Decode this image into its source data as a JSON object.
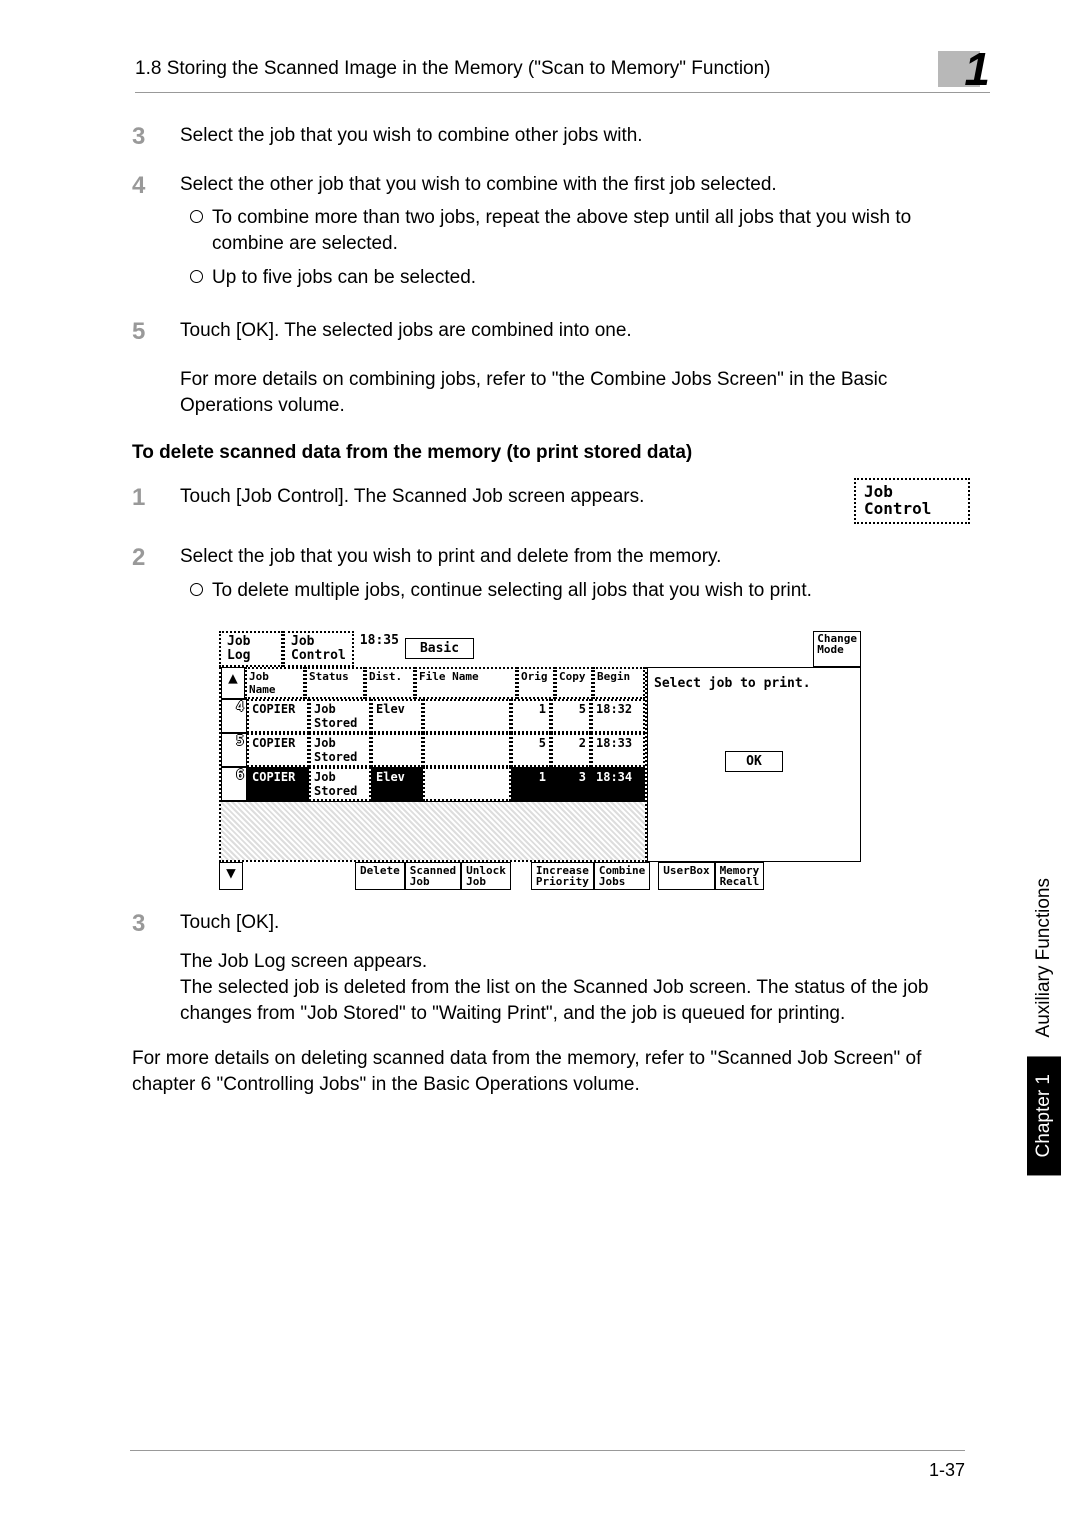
{
  "header": {
    "section_title": "1.8 Storing the Scanned Image in the Memory (\"Scan to Memory\" Function)",
    "chapter_number_glyph": "1"
  },
  "sidebar": {
    "chapter": "Chapter 1",
    "section": "Auxiliary Functions"
  },
  "steps_a": {
    "s3": {
      "n": "3",
      "text": "Select the job that you wish to combine other jobs with."
    },
    "s4": {
      "n": "4",
      "text": "Select the other job that you wish to combine with the first job selected.",
      "sub1": "To combine more than two jobs, repeat the above step until all jobs that you wish to combine are selected.",
      "sub2": "Up to five jobs can be selected."
    },
    "s5": {
      "n": "5",
      "text": "Touch [OK]. The selected jobs are combined into one.",
      "after": "For more details on combining jobs, refer to \"the Combine Jobs Screen\" in the Basic Operations volume."
    }
  },
  "h3": "To delete scanned data from the memory (to print stored data)",
  "job_control_btn": {
    "l1": "Job",
    "l2": "Control"
  },
  "steps_b": {
    "s1": {
      "n": "1",
      "text": "Touch [Job Control]. The Scanned Job screen appears."
    },
    "s2": {
      "n": "2",
      "text": "Select the job that you wish to print and delete from the memory.",
      "sub1": "To delete multiple jobs, continue selecting all jobs that you wish to print."
    },
    "s3": {
      "n": "3",
      "text": "Touch [OK].",
      "after1": "The Job Log screen appears.",
      "after2": "The selected job is deleted from the list on the Scanned Job screen. The status of the job changes from \"Job Stored\" to \"Waiting Print\", and the job is queued for printing."
    }
  },
  "closing": "For more details on deleting scanned data from the memory, refer to \"Scanned Job Screen\" of chapter 6 \"Controlling Jobs\" in the Basic Operations volume.",
  "screen": {
    "tabs": {
      "job_log": {
        "l1": "Job",
        "l2": "Log"
      },
      "job_control": {
        "l1": "Job",
        "l2": "Control"
      },
      "time": "18:35",
      "basic": "Basic",
      "change_mode": {
        "l1": "Change",
        "l2": "Mode"
      }
    },
    "columns": {
      "job_name": {
        "l1": "Job",
        "l2": "Name"
      },
      "status": "Status",
      "dist": "Dist.",
      "file_name": "File Name",
      "orig": "Orig",
      "copy": "Copy",
      "begin": "Begin"
    },
    "side_msg": "Select job to print.",
    "ok": "OK",
    "rows": [
      {
        "idx": "4",
        "name": "COPIER",
        "status_l1": "Job",
        "status_l2": "Stored",
        "dist": "Elev",
        "file": "",
        "orig": "1",
        "copy": "5",
        "begin": "18:32",
        "sel": false
      },
      {
        "idx": "5",
        "name": "COPIER",
        "status_l1": "Job",
        "status_l2": "Stored",
        "dist": "",
        "file": "",
        "orig": "5",
        "copy": "2",
        "begin": "18:33",
        "sel": false
      },
      {
        "idx": "6",
        "name": "COPIER",
        "status_l1": "Job",
        "status_l2": "Stored",
        "dist": "Elev",
        "file": "",
        "orig": "1",
        "copy": "3",
        "begin": "18:34",
        "sel": true
      }
    ],
    "footer": {
      "delete": "Delete",
      "scanned_job": {
        "l1": "Scanned",
        "l2": "Job"
      },
      "unlock_job": {
        "l1": "Unlock",
        "l2": "Job"
      },
      "increase_priority": {
        "l1": "Increase",
        "l2": "Priority"
      },
      "combine_jobs": {
        "l1": "Combine",
        "l2": "Jobs"
      },
      "userbox": "UserBox",
      "memory_recall": {
        "l1": "Memory",
        "l2": "Recall"
      }
    }
  },
  "page_number": "1-37"
}
